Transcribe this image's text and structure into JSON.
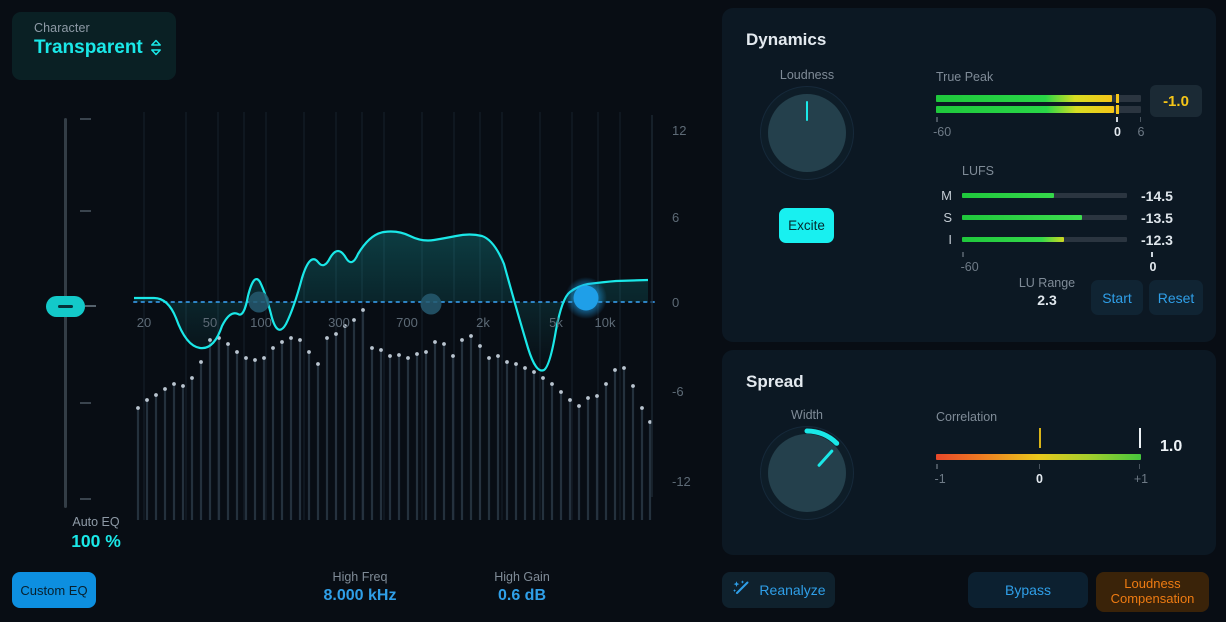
{
  "character": {
    "label": "Character",
    "value": "Transparent",
    "icon": "updown-chevron-icon"
  },
  "auto_eq": {
    "label": "Auto EQ",
    "value": "100 %",
    "slider_percent": 100
  },
  "custom_eq_button": {
    "label": "Custom EQ",
    "active": true
  },
  "band_readouts": [
    {
      "name": "High Freq",
      "value": "8.000 kHz"
    },
    {
      "name": "High Gain",
      "value": "0.6 dB"
    }
  ],
  "eq_graph": {
    "freq_labels": [
      "20",
      "50",
      "100",
      "300",
      "700",
      "2k",
      "5k",
      "10k"
    ],
    "db_labels": [
      "12",
      "6",
      "0",
      "-6",
      "-12"
    ],
    "nodes": [
      {
        "name": "band-node-low",
        "freq": "100",
        "selected": false
      },
      {
        "name": "band-node-mid",
        "freq": "800",
        "selected": false
      },
      {
        "name": "band-node-high",
        "freq": "8k",
        "selected": true
      }
    ]
  },
  "dynamics": {
    "title": "Dynamics",
    "loudness": {
      "label": "Loudness",
      "knob_angle": 0
    },
    "excite": {
      "label": "Excite",
      "active": true
    },
    "true_peak": {
      "label": "True Peak",
      "value": "-1.0",
      "scale": [
        {
          "text": "-60",
          "pos": 0,
          "highlight": false
        },
        {
          "text": "0",
          "pos": 88,
          "highlight": true
        },
        {
          "text": "6",
          "pos": 100,
          "highlight": false
        }
      ],
      "bars": [
        {
          "fill": 86,
          "peak": 88
        },
        {
          "fill": 87,
          "peak": 88
        }
      ]
    },
    "lufs": {
      "label": "LUFS",
      "rows": [
        {
          "key": "M",
          "value": "-14.5",
          "fill": 56
        },
        {
          "key": "S",
          "value": "-13.5",
          "fill": 73
        },
        {
          "key": "I",
          "value": "-12.3",
          "fill": 62
        }
      ],
      "scale": [
        {
          "text": "-60",
          "pos": 0,
          "highlight": false
        },
        {
          "text": "0",
          "pos": 100,
          "highlight": true
        }
      ]
    },
    "lu_range": {
      "label": "LU Range",
      "value": "2.3"
    },
    "start_button": "Start",
    "reset_button": "Reset"
  },
  "spread": {
    "title": "Spread",
    "width": {
      "label": "Width",
      "knob_angle": 42
    },
    "correlation": {
      "label": "Correlation",
      "value": "1.0",
      "markers": [
        {
          "pos": 50,
          "color": "#d8b318"
        },
        {
          "pos": 99,
          "color": "#ecf1f5"
        }
      ],
      "scale": [
        {
          "text": "-1",
          "pos": 0,
          "highlight": false
        },
        {
          "text": "0",
          "pos": 50,
          "highlight": true
        },
        {
          "text": "+1",
          "pos": 99,
          "highlight": false
        }
      ]
    }
  },
  "actions": {
    "reanalyze": {
      "label": "Reanalyze",
      "icon": "magic-wand-sparkle-icon"
    },
    "bypass": {
      "label": "Bypass",
      "active": false
    },
    "loudness_compensation": {
      "line1": "Loudness",
      "line2": "Compensation",
      "active": true
    }
  },
  "colors": {
    "accent_cyan": "#1ae8e8",
    "accent_blue": "#2f9fe8",
    "warning_yellow": "#f5c518",
    "active_orange": "#ee7b12",
    "panel_bg": "#0c1823",
    "app_bg": "#080d14"
  }
}
